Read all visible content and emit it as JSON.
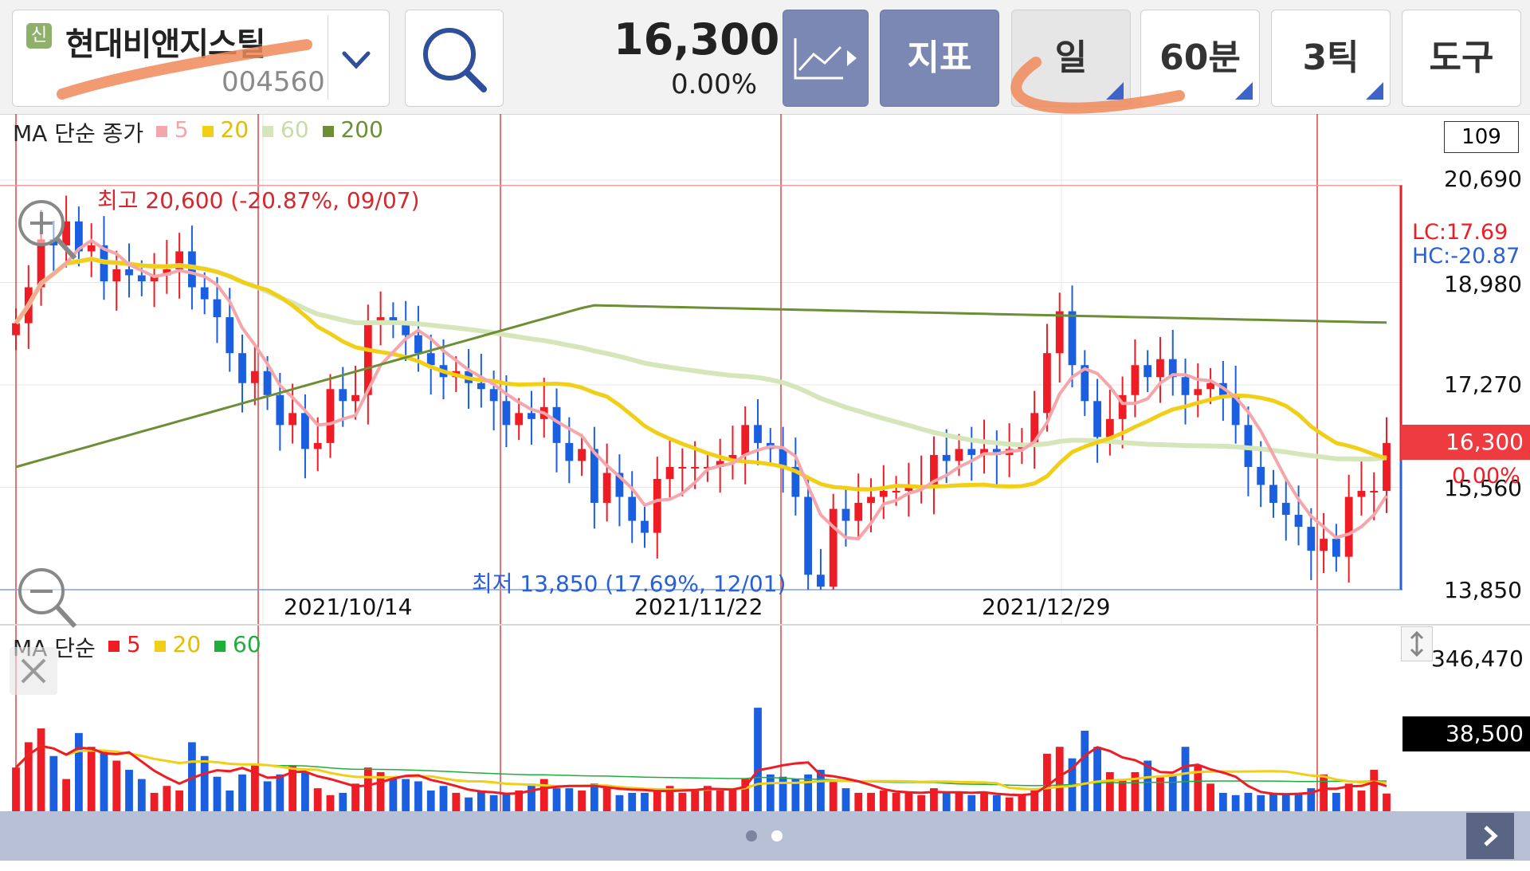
{
  "header": {
    "badge": "신",
    "stock_name": "현대비앤지스틸",
    "stock_code": "004560",
    "price": "16,300",
    "change": "0.00%",
    "buttons": {
      "chart_type_icon": "line-chart-icon",
      "indicator": "지표",
      "daily": "일",
      "minute": "60분",
      "tick": "3틱",
      "tools": "도구"
    }
  },
  "main_chart": {
    "ma_title": "MA 단순 종가",
    "legend": [
      {
        "label": "5",
        "color": "#f4a6ab"
      },
      {
        "label": "20",
        "color": "#f1cf16"
      },
      {
        "label": "60",
        "color": "#d6e6bb"
      },
      {
        "label": "200",
        "color": "#6c8f35"
      }
    ],
    "count_box": "109",
    "high_label": "최고 20,600 (-20.87%, 09/07)",
    "low_label": "최저 13,850 (17.69%, 12/01)",
    "lc": "LC:17.69",
    "hc": "HC:-20.87",
    "price_badge": "16,300",
    "price_badge_change": "0.00%",
    "y_ticks": [
      "20,690",
      "18,980",
      "17,270",
      "15,560",
      "13,850"
    ],
    "x_ticks": [
      "2021/10/14",
      "2021/11/22",
      "2021/12/29"
    ]
  },
  "volume_chart": {
    "ma_title": "MA 단순",
    "legend": [
      {
        "label": "5",
        "color": "#ee1c24"
      },
      {
        "label": "20",
        "color": "#f1cf16"
      },
      {
        "label": "60",
        "color": "#1fae3a"
      }
    ],
    "y_top": "346,470",
    "current_volume": "38,500"
  },
  "chart_data": [
    {
      "type": "candlestick",
      "title": "",
      "ylim": [
        13850,
        20690
      ],
      "y_ticks": [
        20690,
        18980,
        17270,
        15560,
        13850
      ],
      "x_ticks": [
        "2021/10/14",
        "2021/11/22",
        "2021/12/29"
      ],
      "high": {
        "value": 20600,
        "date": "09/07"
      },
      "low": {
        "value": 13850,
        "date": "12/01"
      },
      "last_close": 16300,
      "close": [
        18300,
        18900,
        19700,
        19600,
        20000,
        19500,
        19600,
        19000,
        19200,
        19100,
        19000,
        19100,
        19200,
        19500,
        18900,
        18700,
        18400,
        17800,
        17300,
        17500,
        17100,
        16600,
        16800,
        16200,
        16300,
        17200,
        17000,
        17100,
        18300,
        18400,
        18300,
        18100,
        17800,
        17600,
        17400,
        17500,
        17300,
        17200,
        17000,
        16600,
        16800,
        16700,
        16900,
        16300,
        16000,
        16200,
        15300,
        15800,
        15400,
        15000,
        14800,
        15700,
        15900,
        15900,
        15900,
        15900,
        16000,
        16100,
        16600,
        16300,
        16200,
        15900,
        15400,
        14100,
        13900,
        15200,
        15000,
        15300,
        15400,
        15500,
        15500,
        15600,
        15600,
        16100,
        16000,
        16200,
        16100,
        16200,
        16100,
        16200,
        16300,
        16800,
        17800,
        18500,
        17600,
        17000,
        16400,
        16700,
        17100,
        17600,
        17400,
        17700,
        17400,
        17100,
        17200,
        17300,
        17100,
        16600,
        15900,
        15600,
        15300,
        15100,
        14900,
        14500,
        14700,
        14400,
        15400,
        15500,
        15500,
        16300
      ]
    },
    {
      "type": "bar",
      "title": "",
      "ylim": [
        0,
        346470
      ],
      "last_value": 38500,
      "values": [
        95000,
        150000,
        180000,
        120000,
        70000,
        170000,
        140000,
        130000,
        110000,
        90000,
        70000,
        40000,
        55000,
        45000,
        150000,
        120000,
        75000,
        45000,
        80000,
        100000,
        65000,
        80000,
        100000,
        85000,
        50000,
        35000,
        40000,
        60000,
        95000,
        85000,
        75000,
        70000,
        65000,
        45000,
        55000,
        40000,
        30000,
        45000,
        35000,
        40000,
        45000,
        60000,
        70000,
        50000,
        50000,
        45000,
        60000,
        55000,
        35000,
        40000,
        40000,
        50000,
        55000,
        40000,
        45000,
        55000,
        45000,
        50000,
        70000,
        225000,
        80000,
        75000,
        70000,
        80000,
        90000,
        65000,
        50000,
        40000,
        40000,
        45000,
        40000,
        40000,
        35000,
        50000,
        40000,
        40000,
        35000,
        40000,
        35000,
        30000,
        35000,
        50000,
        125000,
        140000,
        115000,
        175000,
        140000,
        85000,
        70000,
        85000,
        110000,
        75000,
        80000,
        140000,
        100000,
        60000,
        40000,
        35000,
        40000,
        35000,
        40000,
        35000,
        40000,
        50000,
        80000,
        40000,
        60000,
        45000,
        90000,
        38500
      ]
    }
  ]
}
